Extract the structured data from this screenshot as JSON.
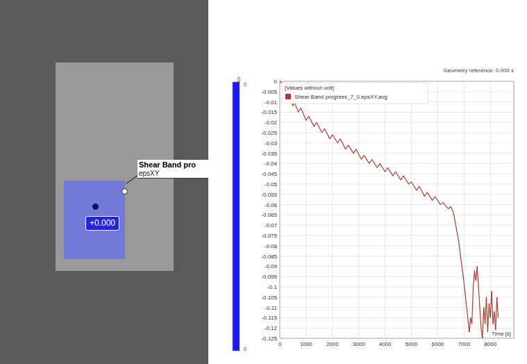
{
  "photo": {
    "overlay": {
      "label": "Shear Band pro",
      "sublabel": "epsXY",
      "badge": "+0.000"
    }
  },
  "chart": {
    "geometry_reference": "Geometry reference: 0.000 s",
    "colorbar": {
      "unit": "[]",
      "max": "0",
      "min": "0"
    },
    "legend": {
      "note": "[Values without unit]"
    },
    "y_ticks": [
      "0",
      "-0.005",
      "-0.01",
      "-0.015",
      "-0.02",
      "-0.025",
      "-0.03",
      "-0.035",
      "-0.04",
      "-0.045",
      "-0.05",
      "-0.055",
      "-0.06",
      "-0.065",
      "-0.07",
      "-0.075",
      "-0.08",
      "-0.085",
      "-0.09",
      "-0.095",
      "-0.1",
      "-0.105",
      "-0.11",
      "-0.115",
      "-0.12",
      "-0.125"
    ],
    "x_ticks": [
      "0",
      "1000",
      "2000",
      "3000",
      "4000",
      "5000",
      "6000",
      "7000",
      "8000"
    ],
    "x_label": "Time [s]",
    "series": [
      {
        "name": "Shear Band progrees_7_0.epsXY.avg",
        "color": "#b03a2e",
        "times": [
          0,
          200,
          400,
          500,
          550,
          700,
          800,
          1000,
          1100,
          1300,
          1400,
          1600,
          1700,
          1900,
          2000,
          2200,
          2300,
          2500,
          2600,
          2800,
          2900,
          3100,
          3200,
          3400,
          3500,
          3700,
          3800,
          4000,
          4100,
          4300,
          4400,
          4600,
          4700,
          4900,
          5000,
          5200,
          5300,
          5500,
          5600,
          5800,
          5900,
          6100,
          6200,
          6400,
          6500,
          6600,
          6800,
          7000,
          7100,
          7200,
          7250,
          7300,
          7350,
          7400,
          7450,
          7500,
          7550,
          7600,
          7650,
          7700,
          7750,
          7800,
          7850,
          7900,
          7950,
          8000,
          8050,
          8100,
          8150,
          8200,
          8250,
          8300
        ],
        "values": [
          0,
          -0.002,
          -0.008,
          -0.012,
          -0.01,
          -0.015,
          -0.013,
          -0.019,
          -0.017,
          -0.022,
          -0.02,
          -0.025,
          -0.023,
          -0.028,
          -0.026,
          -0.03,
          -0.028,
          -0.033,
          -0.031,
          -0.035,
          -0.033,
          -0.038,
          -0.036,
          -0.04,
          -0.038,
          -0.042,
          -0.04,
          -0.044,
          -0.042,
          -0.046,
          -0.044,
          -0.048,
          -0.046,
          -0.05,
          -0.049,
          -0.053,
          -0.051,
          -0.056,
          -0.054,
          -0.058,
          -0.056,
          -0.06,
          -0.059,
          -0.062,
          -0.061,
          -0.064,
          -0.078,
          -0.098,
          -0.11,
          -0.122,
          -0.115,
          -0.118,
          -0.1,
          -0.092,
          -0.097,
          -0.09,
          -0.1,
          -0.11,
          -0.12,
          -0.125,
          -0.11,
          -0.118,
          -0.105,
          -0.122,
          -0.108,
          -0.115,
          -0.102,
          -0.118,
          -0.112,
          -0.121,
          -0.105,
          -0.115
        ]
      }
    ]
  }
}
